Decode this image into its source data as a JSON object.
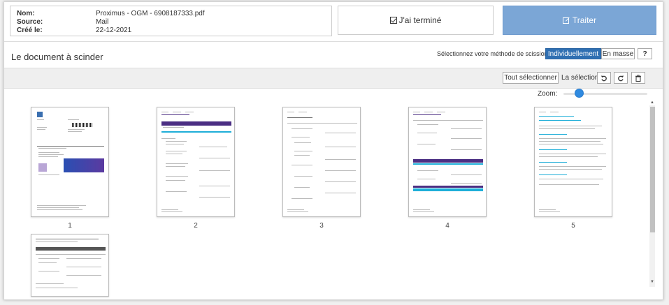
{
  "info": {
    "nom_label": "Nom:",
    "nom_value": "Proximus - OGM - 6908187333.pdf",
    "source_label": "Source:",
    "source_value": "Mail",
    "cree_label": "Créé le:",
    "cree_value": "22-12-2021"
  },
  "actions": {
    "done_label": "J'ai terminé",
    "process_label": "Traiter"
  },
  "header": {
    "title": "Le document à scinder",
    "method_label": "Sélectionnez votre méthode de scission:",
    "method_individual": "Individuellement",
    "method_mass": "En masse",
    "help_label": "?"
  },
  "toolbar": {
    "select_all": "Tout sélectionner",
    "selection_label": "La sélection:",
    "zoom_label": "Zoom:"
  },
  "pages": [
    {
      "number": "1"
    },
    {
      "number": "2"
    },
    {
      "number": "3"
    },
    {
      "number": "4"
    },
    {
      "number": "5"
    },
    {
      "number": ""
    }
  ],
  "colors": {
    "primary": "#2f6fb2",
    "process_button": "#7ba6d6",
    "slider": "#2f8ae0",
    "invoice_purple": "#4b2e83",
    "invoice_cyan": "#1eaed8"
  }
}
